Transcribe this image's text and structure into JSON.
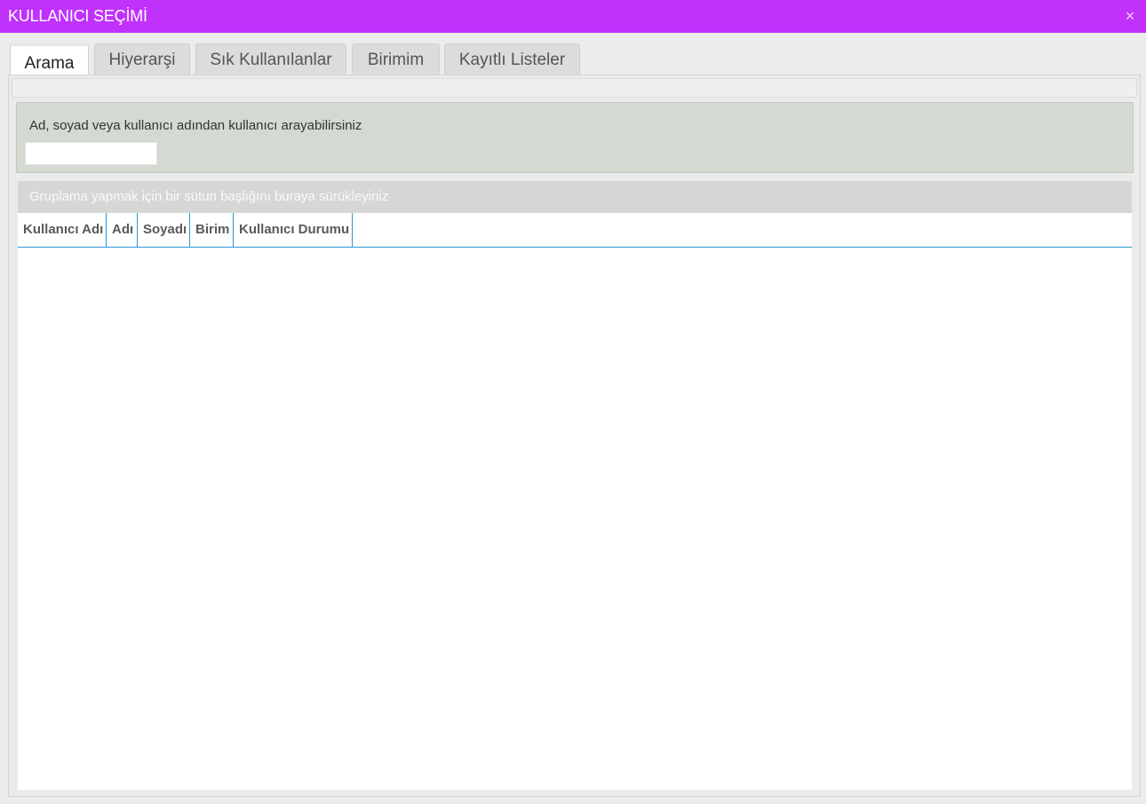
{
  "window": {
    "title": "KULLANICI SEÇİMİ",
    "close_icon": "×"
  },
  "tabs": [
    {
      "label": "Arama",
      "active": true
    },
    {
      "label": "Hiyerarşi",
      "active": false
    },
    {
      "label": "Sık Kullanılanlar",
      "active": false
    },
    {
      "label": "Birimim",
      "active": false
    },
    {
      "label": "Kayıtlı Listeler",
      "active": false
    }
  ],
  "search": {
    "hint": "Ad, soyad veya kullanıcı adından kullanıcı arayabilirsiniz",
    "value": "",
    "placeholder": ""
  },
  "grid": {
    "group_panel_text": "Gruplama yapmak için bir sütun başlığını buraya sürükleyiniz",
    "columns": [
      "Kullanıcı Adı",
      "Adı",
      "Soyadı",
      "Birim",
      "Kullanıcı Durumu"
    ],
    "rows": []
  },
  "colors": {
    "titlebar": "#c032fb",
    "header_border": "#2c97d4",
    "search_bg": "#d4d9d2"
  }
}
